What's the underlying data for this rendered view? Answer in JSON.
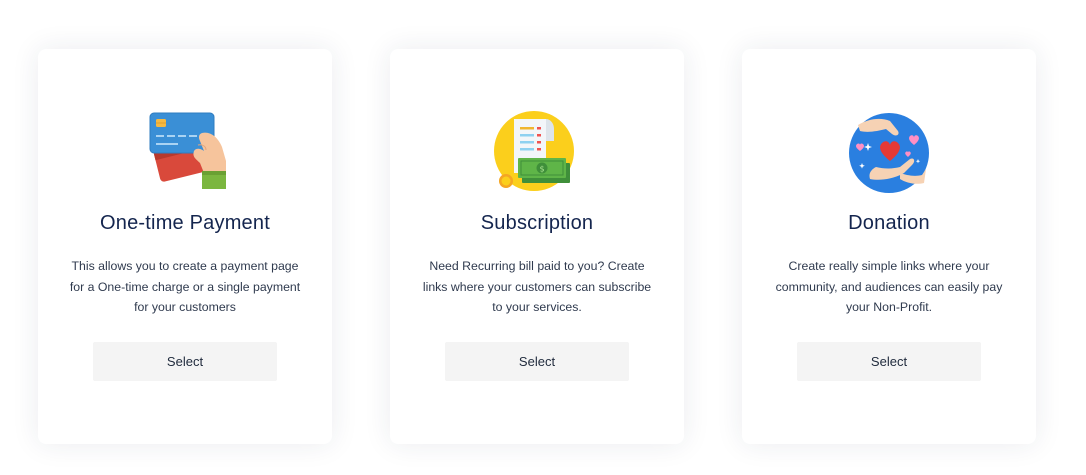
{
  "options": [
    {
      "title": "One-time Payment",
      "description": "This allows you to create a payment page for a One-time charge or a single payment for your customers",
      "button_label": "Select",
      "icon": "credit-card-icon"
    },
    {
      "title": "Subscription",
      "description": "Need Recurring bill paid to you? Create links where your customers can subscribe to your services.",
      "button_label": "Select",
      "icon": "receipt-cash-icon"
    },
    {
      "title": "Donation",
      "description": "Create really simple links where your community, and audiences can easily pay your Non-Profit.",
      "button_label": "Select",
      "icon": "donation-heart-icon"
    }
  ],
  "colors": {
    "title": "#14254e",
    "text": "#2f3a4e",
    "button_bg": "#f4f4f4",
    "card_bg": "#ffffff"
  }
}
